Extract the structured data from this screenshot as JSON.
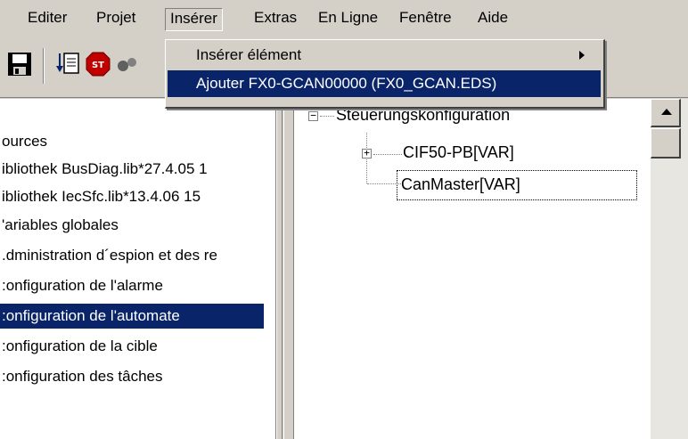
{
  "menubar": {
    "items": [
      {
        "label": "Editer"
      },
      {
        "label": "Projet"
      },
      {
        "label": "Insérer"
      },
      {
        "label": "Extras"
      },
      {
        "label": "En Ligne"
      },
      {
        "label": "Fenêtre"
      },
      {
        "label": "Aide"
      }
    ]
  },
  "insert_menu": {
    "items": [
      {
        "label": "Insérer élément",
        "has_submenu": true
      },
      {
        "label": "Ajouter FX0-GCAN00000 (FX0_GCAN.EDS)",
        "highlighted": true
      }
    ]
  },
  "left_panel": {
    "items": [
      {
        "label": "ources"
      },
      {
        "label": "ibliothek BusDiag.lib*27.4.05 1"
      },
      {
        "label": "ibliothek IecSfc.lib*13.4.06 15"
      },
      {
        "label": "'ariables globales"
      },
      {
        "label": ".dministration d´espion et des re"
      },
      {
        "label": ":onfiguration de l'alarme"
      },
      {
        "label": ":onfiguration de l'automate",
        "selected": true
      },
      {
        "label": ":onfiguration de la cible"
      },
      {
        "label": ":onfiguration des tâches"
      }
    ]
  },
  "config_tree": {
    "root": "Steuerungskonfiguration",
    "children": [
      {
        "label": "CIF50-PB[VAR]"
      },
      {
        "label": "CanMaster[VAR]",
        "focused": true
      }
    ]
  },
  "colors": {
    "selection": "#0a246a",
    "face": "#d4d0c8"
  }
}
